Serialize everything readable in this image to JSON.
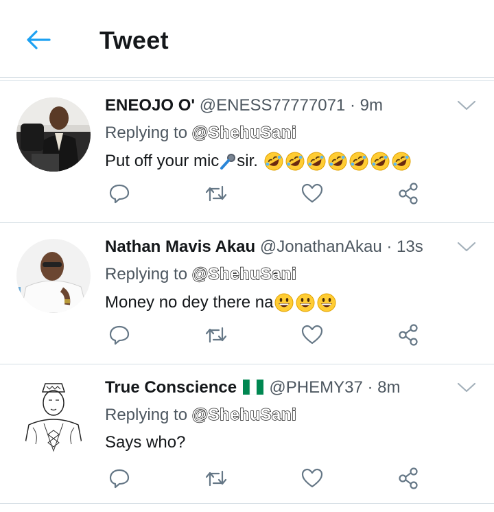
{
  "header": {
    "title": "Tweet"
  },
  "colors": {
    "accent": "#1da1f2",
    "action_icon": "#657786",
    "emoji_yellow": "#ffcc33",
    "nigeria_green": "#008751"
  },
  "tweets": [
    {
      "name": "ENEOJO O'",
      "handle": "@ENESS77777071",
      "dot": "·",
      "time": "9m",
      "reply_label": "Replying to",
      "mention": "@ShehuSani",
      "text": "Put off your mic",
      "text_after": " sir.",
      "emojis": [
        "microphone",
        "rofl",
        "rofl",
        "rofl",
        "rofl",
        "rofl",
        "rofl",
        "rofl"
      ]
    },
    {
      "name": "Nathan Mavis Akau",
      "handle": "@JonathanAkau",
      "dot": "·",
      "time": "13s",
      "reply_label": "Replying to",
      "mention": "@ShehuSani",
      "text": "Money no dey there na",
      "emojis": [
        "smiley",
        "smiley",
        "smiley"
      ]
    },
    {
      "name": "True Conscience",
      "flag": "nigeria-flag",
      "handle": "@PHEMY37",
      "dot": "·",
      "time": "8m",
      "reply_label": "Replying to",
      "mention": "@ShehuSani",
      "text": "Says who?"
    }
  ],
  "actions": [
    "reply-icon",
    "retweet-icon",
    "like-icon",
    "share-icon"
  ]
}
